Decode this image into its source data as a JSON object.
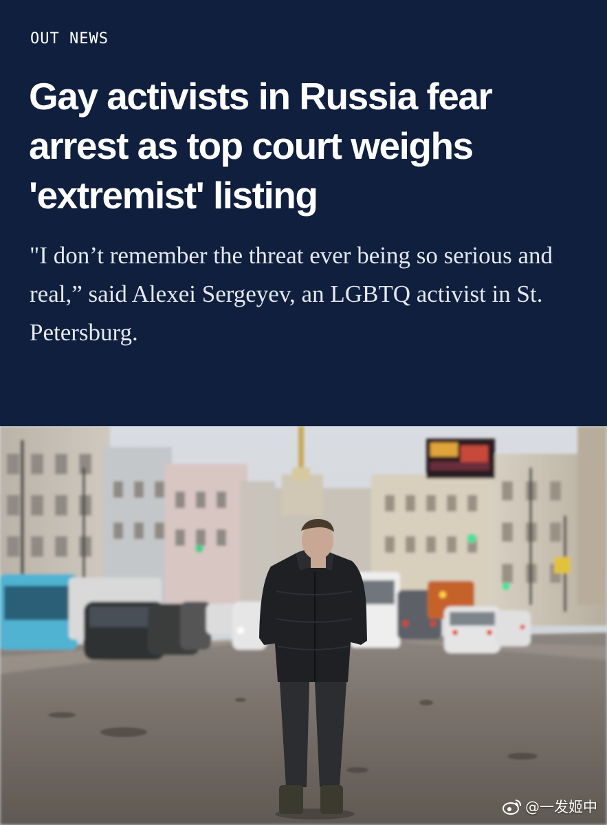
{
  "article": {
    "kicker": "OUT NEWS",
    "headline": "Gay activists in Russia fear arrest as top court weighs 'extremist' listing",
    "dek": "\"I don’t remember the threat ever being so serious and real,” said Alexei Sergeyev, an LGBTQ activist in St. Petersburg."
  },
  "photo": {
    "watermark_handle": "@一发姬中",
    "watermark_icon": "weibo-icon"
  },
  "colors": {
    "header_bg": "#0f1f3d",
    "text_primary": "#ffffff"
  }
}
